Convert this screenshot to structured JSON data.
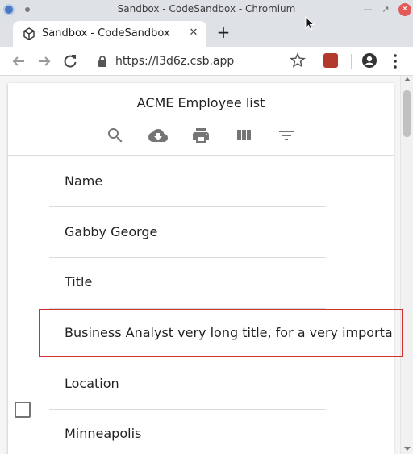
{
  "window": {
    "title": "Sandbox - CodeSandbox - Chromium"
  },
  "tab": {
    "title": "Sandbox - CodeSandbox",
    "close": "✕",
    "new_tab": "+"
  },
  "toolbar": {
    "url": "https://l3d6z.csb.app"
  },
  "table": {
    "title": "ACME Employee list",
    "tools": [
      "search-icon",
      "download-icon",
      "print-icon",
      "view-columns-icon",
      "filter-icon"
    ],
    "row": {
      "cells": [
        {
          "header": "Name",
          "value": "Gabby George"
        },
        {
          "header": "Title",
          "value": "Business Analyst very long title, for a very important role"
        },
        {
          "header": "Location",
          "value": "Minneapolis"
        }
      ]
    }
  },
  "colors": {
    "highlight": "#d32f2f",
    "icon": "#757575"
  }
}
